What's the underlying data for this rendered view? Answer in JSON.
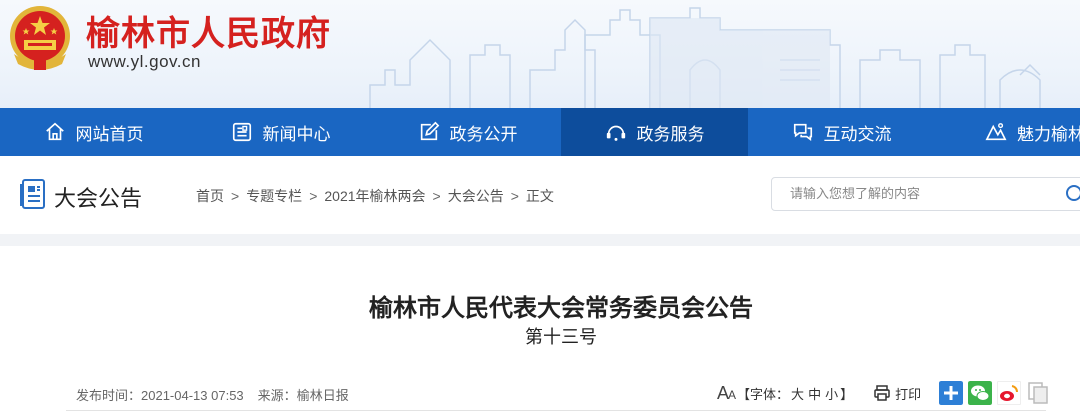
{
  "header": {
    "site_title": "榆林市人民政府",
    "site_url": "www.yl.gov.cn",
    "colors": {
      "title": "#d5211f",
      "nav_bg": "#1a66c2",
      "nav_active": "#0d4d9c"
    }
  },
  "nav": {
    "items": [
      {
        "label": "网站首页",
        "icon": "home-icon"
      },
      {
        "label": "新闻中心",
        "icon": "newspaper-icon"
      },
      {
        "label": "政务公开",
        "icon": "edit-icon"
      },
      {
        "label": "政务服务",
        "icon": "service-icon"
      },
      {
        "label": "互动交流",
        "icon": "chat-icon"
      },
      {
        "label": "魅力榆林",
        "icon": "landscape-icon"
      }
    ],
    "active_index": 3
  },
  "section": {
    "title": "大会公告",
    "icon": "document-icon"
  },
  "breadcrumb": {
    "items": [
      "首页",
      "专题专栏",
      "2021年榆林两会",
      "大会公告",
      "正文"
    ],
    "separator": ">"
  },
  "search": {
    "placeholder": "请输入您想了解的内容",
    "icon": "search-icon"
  },
  "article": {
    "title": "榆林市人民代表大会常务委员会公告",
    "subtitle": "第十三号",
    "meta": {
      "published_label": "发布时间：",
      "published": "2021-04-13 07:53",
      "source_label": "来源：",
      "source": "榆林日报"
    }
  },
  "tools": {
    "font_icon": "font-size-icon",
    "font_label": "【字体：",
    "sizes": [
      "大",
      "中",
      "小"
    ],
    "font_label_end": "】",
    "print_label": "打印",
    "share": [
      {
        "name": "share-plus-icon",
        "color": "#2d7fd6"
      },
      {
        "name": "wechat-icon",
        "color": "#3bb34a"
      },
      {
        "name": "weibo-icon",
        "color": "#e6162d"
      },
      {
        "name": "copy-icon",
        "color": "#c9c9c9"
      }
    ]
  }
}
